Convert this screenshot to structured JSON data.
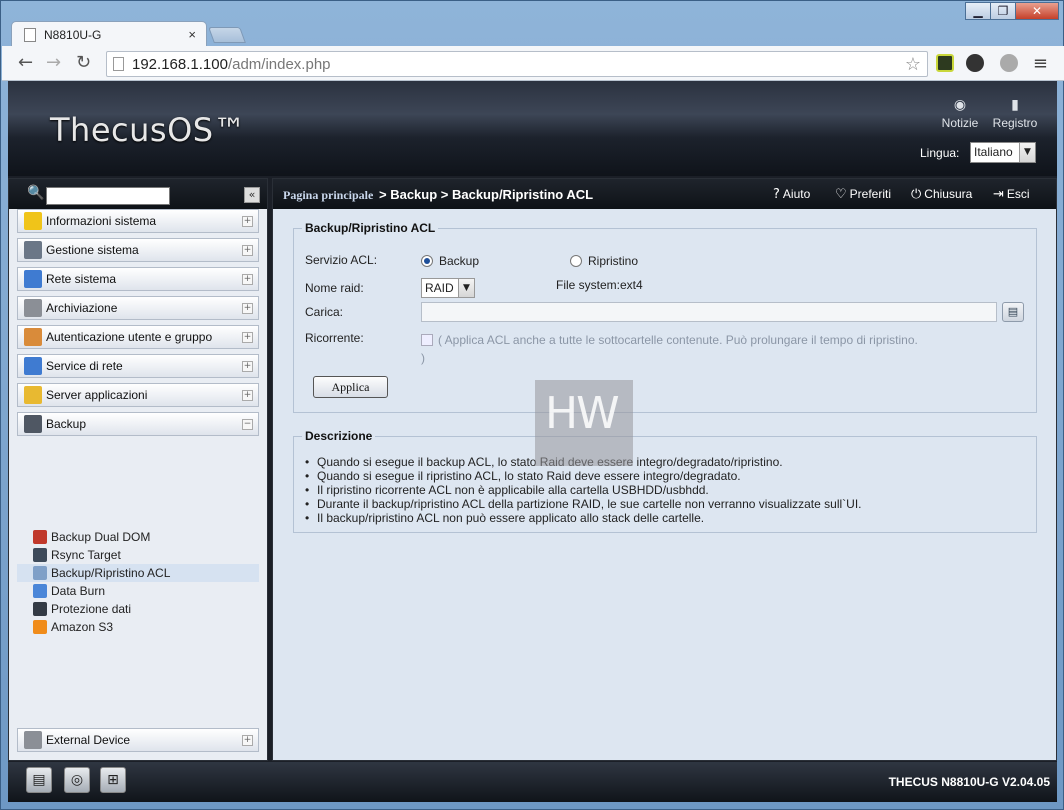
{
  "browser": {
    "tab_title": "N8810U-G",
    "tab_close": "×",
    "url_host": "192.168.1.100",
    "url_path": "/adm/index.php",
    "window_controls": {
      "min": "▁",
      "max": "❐",
      "close": "✕"
    }
  },
  "header": {
    "logo": "ThecusOS™",
    "notifications_label": "Notizie",
    "log_label": "Registro",
    "language_label": "Lingua:",
    "language_value": "Italiano"
  },
  "sidebar": {
    "collapse_icon": "«",
    "categories": [
      {
        "label": "Informazioni sistema",
        "toggle": "+",
        "color": "#f0c419"
      },
      {
        "label": "Gestione sistema",
        "toggle": "+",
        "color": "#6b7787"
      },
      {
        "label": "Rete sistema",
        "toggle": "+",
        "color": "#3f7bd1"
      },
      {
        "label": "Archiviazione",
        "toggle": "+",
        "color": "#8b8f96"
      },
      {
        "label": "Autenticazione utente e gruppo",
        "toggle": "+",
        "color": "#d98b3a"
      },
      {
        "label": "Service di rete",
        "toggle": "+",
        "color": "#3f7bd1"
      },
      {
        "label": "Server applicazioni",
        "toggle": "+",
        "color": "#e8b931"
      },
      {
        "label": "Backup",
        "toggle": "−",
        "color": "#4f5763"
      }
    ],
    "backup_items": [
      {
        "label": "Backup Dual DOM",
        "color": "#c0392b"
      },
      {
        "label": "Rsync Target",
        "color": "#3d4a5a"
      },
      {
        "label": "Backup/Ripristino ACL",
        "color": "#7fa0c8"
      },
      {
        "label": "Data Burn",
        "color": "#4a86d8"
      },
      {
        "label": "Protezione dati",
        "color": "#333a44"
      },
      {
        "label": "Amazon S3",
        "color": "#f08c1a"
      }
    ],
    "external_device": {
      "label": "External Device",
      "toggle": "+"
    }
  },
  "breadcrumb": {
    "home": "Pagina principale",
    "path": "> Backup > Backup/Ripristino ACL",
    "help": "Aiuto",
    "favorites": "Preferiti",
    "shutdown": "Chiusura",
    "logout": "Esci"
  },
  "form": {
    "legend": "Backup/Ripristino ACL",
    "service_label": "Servizio ACL:",
    "option_backup": "Backup",
    "option_restore": "Ripristino",
    "raid_label": "Nome raid:",
    "raid_value": "RAID",
    "filesystem_text": "File system:ext4",
    "upload_label": "Carica:",
    "recurring_label": "Ricorrente:",
    "recurring_note_line1": "( Applica ACL anche a tutte le sottocartelle contenute. Può prolungare il tempo di ripristino.",
    "recurring_note_line2": ")",
    "apply_button": "Applica"
  },
  "description": {
    "legend": "Descrizione",
    "items": [
      "Quando si esegue il backup ACL, lo stato Raid deve essere integro/degradato/ripristino.",
      "Quando si esegue il ripristino ACL, lo stato Raid deve essere integro/degradato.",
      "Il ripristino ricorrente ACL non è applicabile alla cartella USBHDD/usbhdd.",
      "Durante il backup/ripristino ACL della partizione RAID, le sue cartelle non verranno visualizzate sull`UI.",
      "Il backup/ripristino ACL non può essere applicato allo stack delle cartelle."
    ]
  },
  "footer": {
    "version": "THECUS N8810U-G V2.04.05"
  }
}
